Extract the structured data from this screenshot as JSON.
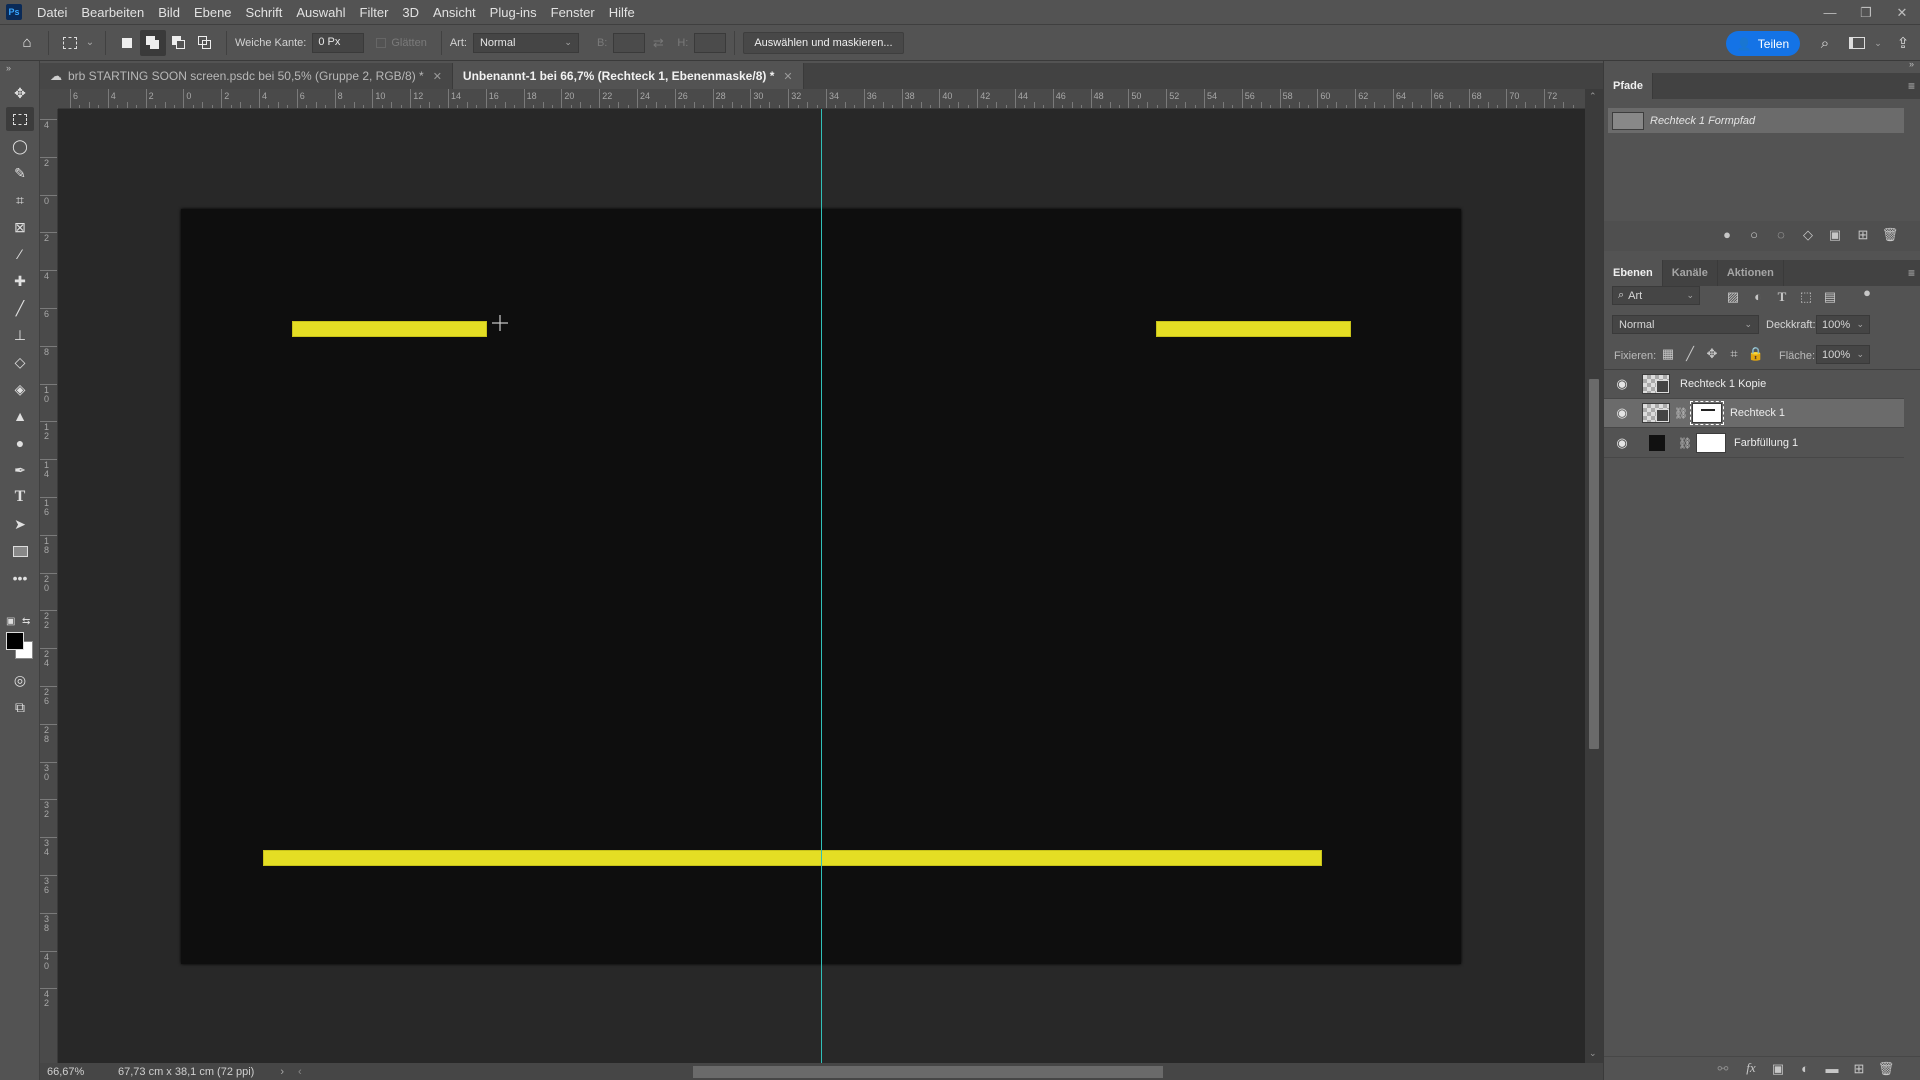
{
  "app": {
    "logo": "Ps",
    "menu": [
      "Datei",
      "Bearbeiten",
      "Bild",
      "Ebene",
      "Schrift",
      "Auswahl",
      "Filter",
      "3D",
      "Ansicht",
      "Plug-ins",
      "Fenster",
      "Hilfe"
    ],
    "window_controls": {
      "minimize": "—",
      "restore": "❐",
      "close": "✕"
    }
  },
  "options_bar": {
    "feather_label": "Weiche Kante:",
    "feather_value": "0 Px",
    "antialias_label": "Glätten",
    "style_label": "Art:",
    "style_value": "Normal",
    "width_label": "B:",
    "height_label": "H:",
    "select_mask_button": "Auswählen und maskieren...",
    "share_button": "Teilen"
  },
  "document_tabs": [
    {
      "label": "brb STARTING SOON screen.psdc bei 50,5% (Gruppe 2, RGB/8) *",
      "active": false,
      "cloud": true
    },
    {
      "label": "Unbenannt-1 bei 66,7% (Rechteck 1, Ebenenmaske/8) *",
      "active": true,
      "cloud": false
    }
  ],
  "rulers": {
    "top": [
      "6",
      "4",
      "2",
      "0",
      "2",
      "4",
      "6",
      "8",
      "10",
      "12",
      "14",
      "16",
      "18",
      "20",
      "22",
      "24",
      "26",
      "28",
      "30",
      "32",
      "34",
      "36",
      "38",
      "40",
      "42",
      "44",
      "46",
      "48",
      "50",
      "52",
      "54",
      "56",
      "58",
      "60",
      "62",
      "64",
      "66",
      "68",
      "70",
      "72"
    ],
    "left": [
      "4",
      "2",
      "0",
      "2",
      "4",
      "6",
      "8",
      "10",
      "12",
      "14",
      "16",
      "18",
      "20",
      "22",
      "24",
      "26",
      "28",
      "30",
      "32",
      "34",
      "36",
      "38",
      "40",
      "42"
    ]
  },
  "canvas": {
    "document_color": "#0e0e0e",
    "bar_color": "#e4de24",
    "guide_color": "#30c0b8"
  },
  "status_bar": {
    "zoom": "66,67%",
    "doc_info": "67,73 cm x 38,1 cm (72 ppi)"
  },
  "paths_panel": {
    "tab": "Pfade",
    "items": [
      {
        "name": "Rechteck 1 Formpfad"
      }
    ]
  },
  "layers_panel": {
    "tabs": [
      "Ebenen",
      "Kanäle",
      "Aktionen"
    ],
    "filter_label": "Art",
    "blend_mode": "Normal",
    "opacity_label": "Deckkraft:",
    "opacity_value": "100%",
    "lock_label": "Fixieren:",
    "fill_label": "Fläche:",
    "fill_value": "100%",
    "layers": [
      {
        "name": "Rechteck 1 Kopie",
        "visible": true,
        "selected": false
      },
      {
        "name": "Rechteck 1",
        "visible": true,
        "selected": true
      },
      {
        "name": "Farbfüllung 1",
        "visible": true,
        "selected": false
      }
    ]
  }
}
